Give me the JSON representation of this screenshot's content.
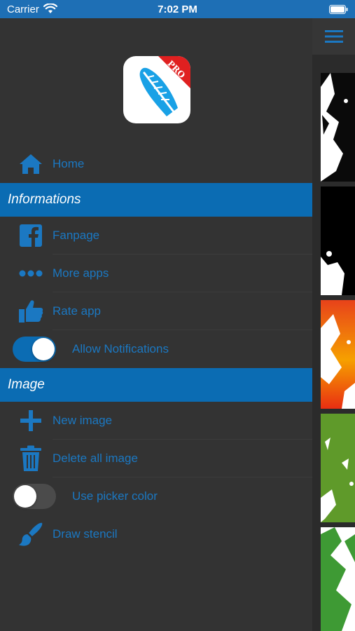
{
  "status_bar": {
    "carrier": "Carrier",
    "time": "7:02 PM"
  },
  "logo": {
    "badge": "PRO",
    "icon": "feather-icon"
  },
  "menu": {
    "home": {
      "label": "Home",
      "icon": "home-icon"
    },
    "informations_header": "Informations",
    "fanpage": {
      "label": "Fanpage",
      "icon": "facebook-icon"
    },
    "more_apps": {
      "label": "More apps",
      "icon": "more-dots-icon"
    },
    "rate_app": {
      "label": "Rate app",
      "icon": "thumbs-up-icon"
    },
    "allow_notifications": {
      "label": "Allow Notifications",
      "enabled": true
    },
    "image_header": "Image",
    "new_image": {
      "label": "New image",
      "icon": "plus-icon"
    },
    "delete_all": {
      "label": "Delete all image",
      "icon": "trash-icon"
    },
    "use_picker": {
      "label": "Use picker color",
      "enabled": false
    },
    "draw_stencil": {
      "label": "Draw stencil",
      "icon": "brush-icon"
    }
  },
  "colors": {
    "accent": "#0b6cb3",
    "label": "#1b78c2",
    "drawer_bg": "#333333"
  }
}
